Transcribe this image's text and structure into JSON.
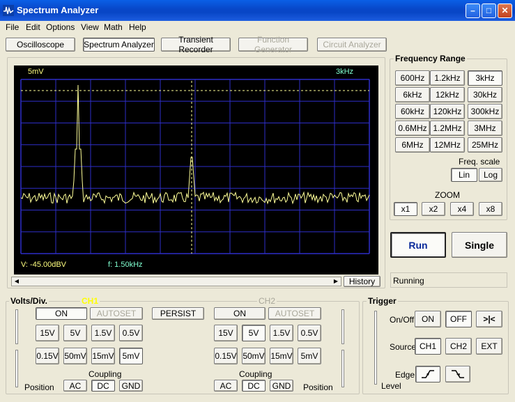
{
  "window": {
    "title": "Spectrum Analyzer"
  },
  "menu": [
    "File",
    "Edit",
    "Options",
    "View",
    "Math",
    "Help"
  ],
  "tabs": [
    {
      "label": "Oscilloscope",
      "state": "normal"
    },
    {
      "label": "Spectrum Analyzer",
      "state": "pressed"
    },
    {
      "label": "Transient Recorder",
      "state": "normal"
    },
    {
      "label": "Function Generator",
      "state": "disabled"
    },
    {
      "label": "Circuit Analyzer",
      "state": "disabled"
    }
  ],
  "display": {
    "top_left": "5mV",
    "top_right": "3kHz",
    "bottom_left": "V: -45.00dBV",
    "bottom_mid": "f: 1.50kHz",
    "trace_color": "#ffff99",
    "grid_color": "#2e2ec8",
    "bg": "#000000"
  },
  "history_label": "History",
  "freq": {
    "title": "Frequency Range",
    "buttons": [
      "600Hz",
      "1.2kHz",
      "3kHz",
      "6kHz",
      "12kHz",
      "30kHz",
      "60kHz",
      "120kHz",
      "300kHz",
      "0.6MHz",
      "1.2MHz",
      "3MHz",
      "6MHz",
      "12MHz",
      "25MHz"
    ],
    "selected": "3kHz",
    "scale_label": "Freq. scale",
    "lin": "Lin",
    "log": "Log",
    "zoom_label": "ZOOM",
    "zoom": [
      "x1",
      "x2",
      "x4",
      "x8"
    ]
  },
  "run": "Run",
  "single": "Single",
  "status": "Running",
  "volts": {
    "title": "Volts/Div.",
    "ch1_label": "CH1",
    "ch2_label": "CH2",
    "on": "ON",
    "autoset": "AUTOSET",
    "persist": "PERSIST",
    "row1": [
      "15V",
      "5V",
      "1.5V",
      "0.5V"
    ],
    "row2": [
      "0.15V",
      "50mV",
      "15mV",
      "5mV"
    ],
    "coupling": "Coupling",
    "ac": "AC",
    "dc": "DC",
    "gnd": "GND",
    "position": "Position",
    "ch1_color": "#ffff00"
  },
  "trigger": {
    "title": "Trigger",
    "onoff": "On/Off",
    "on": "ON",
    "off": "OFF",
    "auto": ">|<",
    "source": "Source",
    "ch1": "CH1",
    "ch2": "CH2",
    "ext": "EXT",
    "edge": "Edge",
    "level": "Level"
  }
}
